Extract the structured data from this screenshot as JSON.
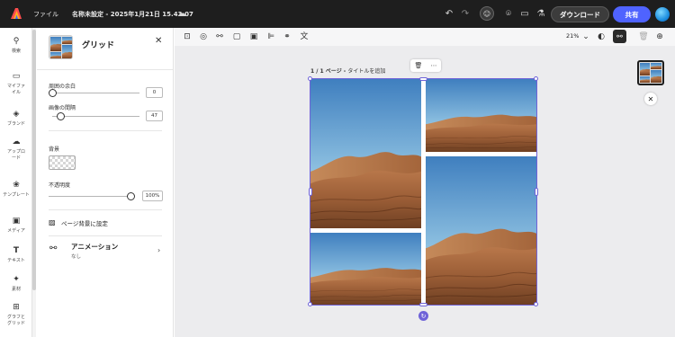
{
  "app": {
    "menu_file": "ファイル",
    "doc_title": "名称未設定 - 2025年1月21日 15.43.07",
    "download_label": "ダウンロード",
    "share_label": "共有"
  },
  "icons": {
    "logo": "adobe-express-logo",
    "cloud": "cloud-icon",
    "undo": "undo-icon",
    "redo": "redo-icon",
    "collab": "collaborator-icon",
    "pin": "location-pin-icon",
    "comment": "comment-icon",
    "flask": "flask-icon"
  },
  "rail": {
    "items": [
      {
        "label": "検索",
        "icon": "search-icon"
      },
      {
        "label": "マイファイル",
        "icon": "folder-icon"
      },
      {
        "label": "ブランド",
        "icon": "brand-icon"
      },
      {
        "label": "アップロード",
        "icon": "upload-icon"
      },
      {
        "label": "テンプレート",
        "icon": "template-icon"
      },
      {
        "label": "メディア",
        "icon": "media-icon"
      },
      {
        "label": "テキスト",
        "icon": "text-icon"
      },
      {
        "label": "素材",
        "icon": "elements-icon"
      },
      {
        "label": "グラフとグリッド",
        "icon": "grid-icon"
      }
    ]
  },
  "panel": {
    "title": "グリッド",
    "outer_margin_label": "周囲の余白",
    "outer_margin_value": "0",
    "outer_margin_fraction": 0.0,
    "gap_label": "画像の間隔",
    "gap_value": "47",
    "gap_fraction": 0.1,
    "background_label": "背景",
    "opacity_label": "不透明度",
    "opacity_value": "100%",
    "opacity_fraction": 1.0,
    "set_page_bg_label": "ページ背景に設定",
    "animation_title": "アニメーション",
    "animation_sub": "なし"
  },
  "canvas": {
    "zoom": "21%",
    "page_label_prefix": "1 / 1 ページ - ",
    "page_label_placeholder": "タイトルを追加"
  },
  "colors": {
    "accent": "#4f63ff",
    "selection": "#6f63d8",
    "topbar": "#1e1e1e"
  }
}
